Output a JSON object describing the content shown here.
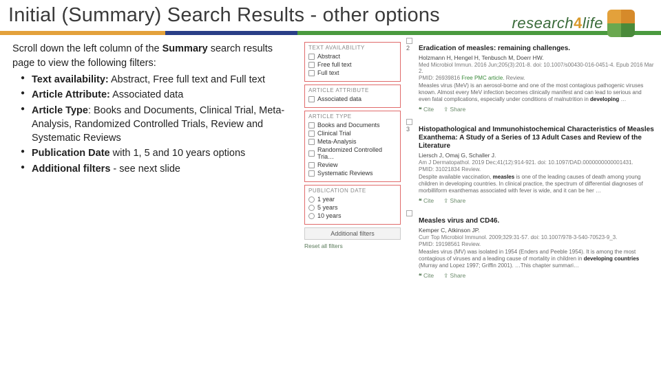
{
  "header": {
    "title": "Initial (Summary) Search Results - other options",
    "brand_text_1": "research",
    "brand_text_2": "4",
    "brand_text_3": "life"
  },
  "left": {
    "intro_pre": "Scroll down the left column of the ",
    "intro_bold": "Summary",
    "intro_post": " search results page to view the following filters:",
    "bullets": [
      {
        "b": "Text availability:",
        "t": " Abstract, Free full text and  Full text"
      },
      {
        "b": "Article Attribute:",
        "t": " Associated data"
      },
      {
        "b": "Article Type",
        "t": ": Books and Documents, Clinical Trial, Meta-Analysis, Randomized Controlled  Trials, Review and Systematic Reviews"
      },
      {
        "b": "Publication Date",
        "t": " with 1, 5 and 10 years options"
      },
      {
        "b": "Additional filters",
        "t": " - see next slide"
      }
    ]
  },
  "filters": {
    "groups": [
      {
        "head": "TEXT AVAILABILITY",
        "type": "cb",
        "items": [
          "Abstract",
          "Free full text",
          "Full text"
        ]
      },
      {
        "head": "ARTICLE ATTRIBUTE",
        "type": "cb",
        "items": [
          "Associated data"
        ]
      },
      {
        "head": "ARTICLE TYPE",
        "type": "cb",
        "items": [
          "Books and Documents",
          "Clinical Trial",
          "Meta-Analysis",
          "Randomized Controlled Tria…",
          "Review",
          "Systematic Reviews"
        ]
      },
      {
        "head": "PUBLICATION DATE",
        "type": "rb",
        "items": [
          "1 year",
          "5 years",
          "10 years"
        ]
      }
    ],
    "additional": "Additional filters",
    "reset": "Reset all filters"
  },
  "results": [
    {
      "idx": "2",
      "title_pre": "Eradication of ",
      "title_hl": "measles",
      "title_post": ": remaining challenges.",
      "authors": "Holzmann H, Hengel H, Tenbusch M, Doerr HW.",
      "cite": "Med Microbiol Immun. 2016 Jun;205(3):201-8. doi: 10.1007/s00430-016-0451-4. Epub 2016 Mar 2.",
      "meta_pmid": "PMID: 26939816",
      "meta_green": "Free PMC article.",
      "meta_tag": "Review.",
      "snip_pre": "Measles virus (MeV) is an aerosol-borne and one of the most contagious pathogenic viruses known. Almost every MeV infection becomes clinically manifest and can lead to serious and even fatal complications, especially under conditions of malnutrition in ",
      "snip_hl": "developing",
      "snip_post": " …",
      "act_cite": "Cite",
      "act_share": "Share"
    },
    {
      "idx": "3",
      "title_pre": "Histopathological and Immunohistochemical Characteristics of Measles Exanthema: A Study of a Series of 13 Adult Cases and Review of the Literature",
      "title_hl": "",
      "title_post": "",
      "authors": "Liersch J, Omaj G, Schaller J.",
      "cite": "Am J Dermatopathol. 2019 Dec;41(12):914-921. doi: 10.1097/DAD.0000000000001431.",
      "meta_pmid": "PMID: 31021834",
      "meta_green": "",
      "meta_tag": "Review.",
      "snip_pre": "Despite available vaccination, ",
      "snip_hl": "measles",
      "snip_post": " is one of the leading causes of death among young children in developing countries. In clinical practice, the spectrum of differential diagnoses of morbilliform exanthemas associated with fever is wide, and it can be her …",
      "act_cite": "Cite",
      "act_share": "Share"
    },
    {
      "idx": "",
      "title_pre": "Measles virus and CD46.",
      "title_hl": "",
      "title_post": "",
      "authors": "Kemper C, Atkinson JP.",
      "cite": "Curr Top Microbiol Immunol. 2009;329:31-57. doi: 10.1007/978-3-540-70523-9_3.",
      "meta_pmid": "PMID: 19198561",
      "meta_green": "",
      "meta_tag": "Review.",
      "snip_pre": "Measles virus (MV) was isolated in 1954 (Enders and Peeble 1954). It is among the most contagious of viruses and a leading cause of mortality in children in ",
      "snip_hl": "developing countries",
      "snip_post": " (Murray and Lopez 1997; Griffin 2001). …This chapter summari…",
      "act_cite": "Cite",
      "act_share": "Share"
    }
  ]
}
